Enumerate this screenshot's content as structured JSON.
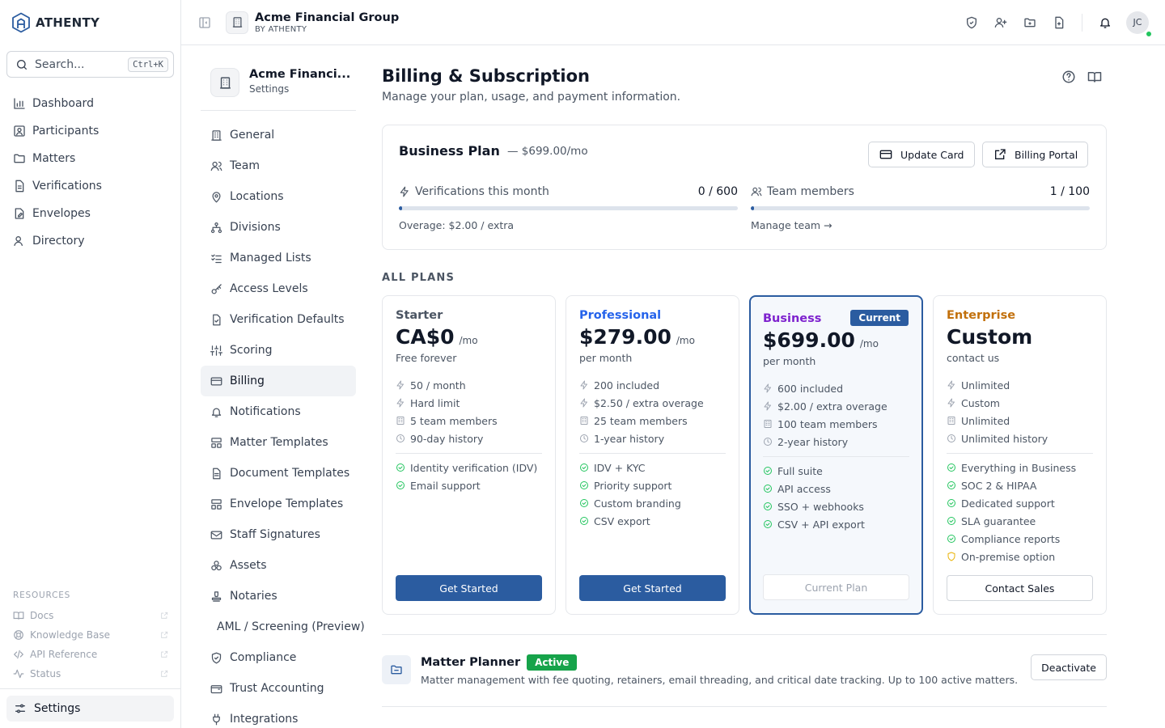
{
  "brand": {
    "name": "ATHENTY"
  },
  "search": {
    "placeholder": "Search...",
    "shortcut": "Ctrl+K"
  },
  "nav": {
    "items": [
      {
        "label": "Dashboard",
        "icon": "bar-chart-icon"
      },
      {
        "label": "Participants",
        "icon": "user-card-icon"
      },
      {
        "label": "Matters",
        "icon": "folder-icon"
      },
      {
        "label": "Verifications",
        "icon": "document-icon"
      },
      {
        "label": "Envelopes",
        "icon": "envelope-edit-icon"
      },
      {
        "label": "Directory",
        "icon": "users-icon"
      }
    ]
  },
  "resources": {
    "label": "RESOURCES",
    "items": [
      {
        "label": "Docs",
        "icon": "book-icon"
      },
      {
        "label": "Knowledge Base",
        "icon": "lifebuoy-icon"
      },
      {
        "label": "API Reference",
        "icon": "code-icon"
      },
      {
        "label": "Status",
        "icon": "activity-icon"
      }
    ]
  },
  "settings": {
    "label": "Settings"
  },
  "topbar": {
    "org_name": "Acme Financial Group",
    "org_by": "BY ATHENTY",
    "avatar_initials": "JC"
  },
  "subnav": {
    "title": "Acme Financi...",
    "subtitle": "Settings",
    "items": [
      {
        "label": "General",
        "icon": "building-icon"
      },
      {
        "label": "Team",
        "icon": "users-icon"
      },
      {
        "label": "Locations",
        "icon": "map-pin-icon"
      },
      {
        "label": "Divisions",
        "icon": "network-icon"
      },
      {
        "label": "Managed Lists",
        "icon": "list-check-icon"
      },
      {
        "label": "Access Levels",
        "icon": "key-icon"
      },
      {
        "label": "Verification Defaults",
        "icon": "file-check-icon"
      },
      {
        "label": "Scoring",
        "icon": "sliders-icon"
      },
      {
        "label": "Billing",
        "icon": "credit-card-icon"
      },
      {
        "label": "Notifications",
        "icon": "bell-icon"
      },
      {
        "label": "Matter Templates",
        "icon": "layout-icon"
      },
      {
        "label": "Document Templates",
        "icon": "file-text-icon"
      },
      {
        "label": "Envelope Templates",
        "icon": "layout-icon"
      },
      {
        "label": "Staff Signatures",
        "icon": "mail-icon"
      },
      {
        "label": "Assets",
        "icon": "boxes-icon"
      },
      {
        "label": "Notaries",
        "icon": "stamp-icon"
      },
      {
        "label": "AML / Screening (Preview)",
        "icon": ""
      },
      {
        "label": "Compliance",
        "icon": "shield-check-icon"
      },
      {
        "label": "Trust Accounting",
        "icon": "wallet-icon"
      },
      {
        "label": "Integrations",
        "icon": "plug-icon"
      }
    ]
  },
  "page": {
    "title": "Billing & Subscription",
    "subtitle": "Manage your plan, usage, and payment information."
  },
  "plan": {
    "name": "Business Plan",
    "price": "— $699.00/mo",
    "update_card": "Update Card",
    "billing_portal": "Billing Portal",
    "usage": [
      {
        "label": "Verifications this month",
        "value": "0 / 600",
        "used": 0,
        "limit": 600,
        "note": "Overage: $2.00 / extra"
      },
      {
        "label": "Team members",
        "value": "1 / 100",
        "used": 1,
        "limit": 100,
        "note": "Manage team →"
      }
    ]
  },
  "all_plans": {
    "label": "ALL PLANS",
    "tiers": [
      {
        "name": "Starter",
        "color": "#4b5563",
        "price": "CA$0",
        "per": "/mo",
        "desc": "Free forever",
        "limits": [
          "50 / month",
          "Hard limit",
          "5 team members",
          "90-day history"
        ],
        "features": [
          "Identity verification (IDV)",
          "Email support"
        ],
        "button": "Get Started",
        "current": false
      },
      {
        "name": "Professional",
        "color": "#2563eb",
        "price": "$279.00",
        "per": "/mo",
        "desc": "per month",
        "limits": [
          "200 included",
          "$2.50 / extra overage",
          "25 team members",
          "1-year history"
        ],
        "features": [
          "IDV + KYC",
          "Priority support",
          "Custom branding",
          "CSV export"
        ],
        "button": "Get Started",
        "current": false
      },
      {
        "name": "Business",
        "color": "#7e22ce",
        "price": "$699.00",
        "per": "/mo",
        "desc": "per month",
        "limits": [
          "600 included",
          "$2.00 / extra overage",
          "100 team members",
          "2-year history"
        ],
        "features": [
          "Full suite",
          "API access",
          "SSO + webhooks",
          "CSV + API export"
        ],
        "button": "Current Plan",
        "current": true,
        "badge": "Current"
      },
      {
        "name": "Enterprise",
        "color": "#c2700c",
        "price": "Custom",
        "per": "",
        "desc": "contact us",
        "limits": [
          "Unlimited",
          "Custom",
          "Unlimited",
          "Unlimited history"
        ],
        "features": [
          "Everything in Business",
          "SOC 2 & HIPAA",
          "Dedicated support",
          "SLA guarantee",
          "Compliance reports",
          "On-premise option"
        ],
        "button": "Contact Sales",
        "current": false
      }
    ]
  },
  "addon": {
    "title": "Matter Planner",
    "badge": "Active",
    "desc": "Matter management with fee quoting, retainers, email threading, and critical date tracking. Up to 100 active matters.",
    "button": "Deactivate"
  }
}
